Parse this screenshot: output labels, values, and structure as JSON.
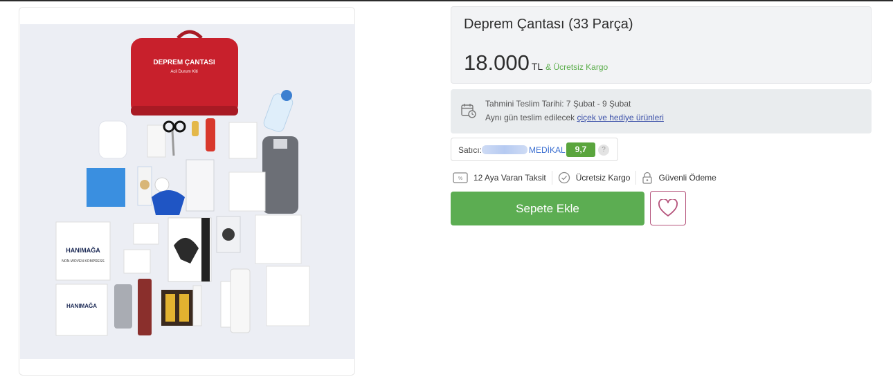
{
  "product": {
    "title": "Deprem Çantası (33 Parça)",
    "price": "18.000",
    "currency": "TL",
    "free_shipping_note": "& Ücretsiz Kargo"
  },
  "delivery": {
    "estimate_label": "Tahmini Teslim Tarihi: 7 Şubat - 9 Şubat",
    "same_day_prefix": "Aynı gün teslim edilecek ",
    "same_day_link": "çiçek ve hediye ürünleri"
  },
  "seller": {
    "label": "Satıcı:",
    "name": "MEDİKAL",
    "score": "9,7",
    "help": "?"
  },
  "features": [
    {
      "label": "12 Aya Varan Taksit",
      "icon": "installment-icon"
    },
    {
      "label": "Ücretsiz Kargo",
      "icon": "check-circle-icon"
    },
    {
      "label": "Güvenli Ödeme",
      "icon": "lock-icon"
    }
  ],
  "actions": {
    "add_to_cart": "Sepete Ekle",
    "favorite_icon": "heart-icon"
  },
  "image": {
    "bag_text": "DEPREM ÇANTASI",
    "bag_subtext": "Acil Durum Kiti",
    "pack_brand": "HANIMAĞA",
    "pack_label": "NON-WOVEN KOMPRESS"
  },
  "colors": {
    "accent_green": "#5cad52",
    "score_green": "#5aa53d",
    "link_blue": "#3a4fa8",
    "favorite_border": "#b4527a",
    "bag_red": "#c8202c"
  }
}
